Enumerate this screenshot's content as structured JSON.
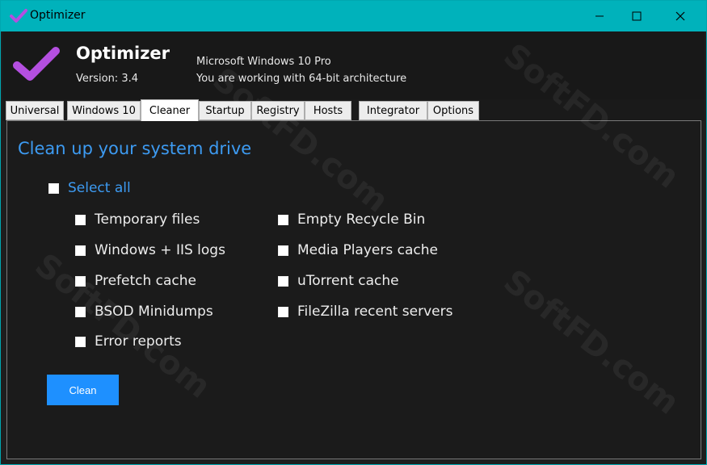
{
  "window": {
    "title": "Optimizer",
    "controls": {
      "minimize": "minimize-icon",
      "maximize": "maximize-icon",
      "close": "close-icon"
    }
  },
  "header": {
    "app_name": "Optimizer",
    "version": "Version: 3.4",
    "os": "Microsoft Windows 10 Pro",
    "architecture": "You are working with 64-bit architecture"
  },
  "tabs": [
    {
      "label": "Universal",
      "active": false
    },
    {
      "label": "Windows 10",
      "active": false
    },
    {
      "label": "Cleaner",
      "active": true
    },
    {
      "label": "Startup",
      "active": false
    },
    {
      "label": "Registry",
      "active": false
    },
    {
      "label": "Hosts",
      "active": false
    },
    {
      "label": "Integrator",
      "active": false
    },
    {
      "label": "Options",
      "active": false
    }
  ],
  "cleaner": {
    "title": "Clean up your system drive",
    "select_all": {
      "label": "Select all",
      "checked": false
    },
    "left_column": [
      {
        "label": "Temporary files",
        "checked": false
      },
      {
        "label": "Windows + IIS logs",
        "checked": false
      },
      {
        "label": "Prefetch cache",
        "checked": false
      },
      {
        "label": "BSOD Minidumps",
        "checked": false
      },
      {
        "label": "Error reports",
        "checked": false
      }
    ],
    "right_column": [
      {
        "label": "Empty Recycle Bin",
        "checked": false
      },
      {
        "label": "Media Players cache",
        "checked": false
      },
      {
        "label": "uTorrent cache",
        "checked": false
      },
      {
        "label": "FileZilla recent servers",
        "checked": false
      }
    ],
    "clean_button": "Clean"
  },
  "colors": {
    "titlebar": "#00b2bb",
    "accent_blue": "#3d9bf2",
    "button_blue": "#1e90ff",
    "logo_purple": "#b44fe0",
    "background": "#1b1b1b"
  },
  "watermark": "SoftFD.com"
}
